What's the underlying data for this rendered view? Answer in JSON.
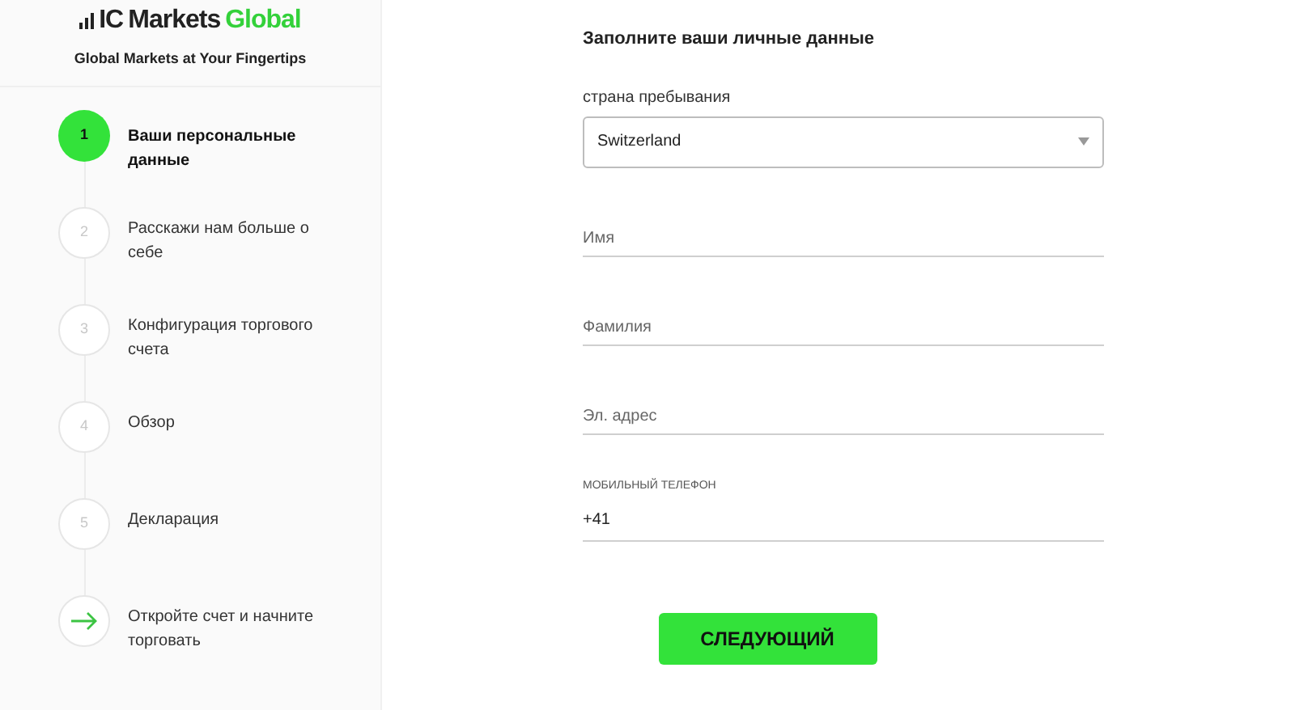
{
  "brand": {
    "logo": [
      {
        "text": "IC",
        "kind": "dark"
      },
      {
        "text": "Markets",
        "kind": "dark"
      },
      {
        "text": "Global",
        "kind": "accent"
      }
    ],
    "tagline": "Global Markets at Your Fingertips"
  },
  "steps": [
    {
      "kind": "number",
      "number": "1",
      "label": "Ваши персональные данные",
      "selected": true
    },
    {
      "kind": "number",
      "number": "2",
      "label": "Расскажи нам больше о себе",
      "selected": false
    },
    {
      "kind": "number",
      "number": "3",
      "label": "Конфигурация торгового счета",
      "selected": false
    },
    {
      "kind": "number",
      "number": "4",
      "label": "Обзор",
      "selected": false
    },
    {
      "kind": "number",
      "number": "5",
      "label": "Декларация",
      "selected": false
    },
    {
      "kind": "arrow",
      "label": "Откройте счет и начните торговать",
      "selected": false
    }
  ],
  "form": {
    "title": "Заполните ваши личные данные",
    "fields": [
      {
        "kind": "select",
        "label": "страна пребывания",
        "value": "Switzerland"
      },
      {
        "kind": "text",
        "placeholder": "Имя"
      },
      {
        "kind": "text",
        "placeholder": "Фамилия"
      },
      {
        "kind": "text",
        "placeholder": "Эл. адрес"
      },
      {
        "kind": "phone",
        "label": "МОБИЛЬНЫЙ ТЕЛЕФОН",
        "value": "+41"
      }
    ],
    "submit": "СЛЕДУЮЩИЙ"
  }
}
